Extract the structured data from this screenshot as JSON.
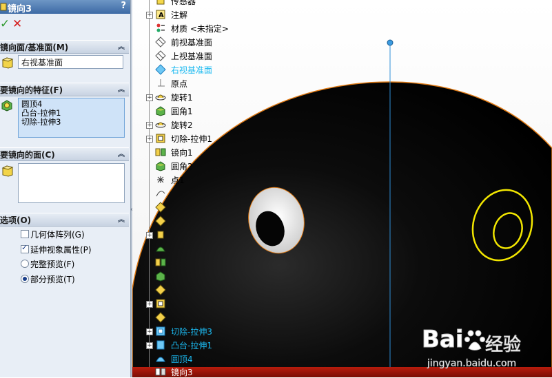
{
  "property_manager": {
    "title": "镜向3",
    "help": "?",
    "ok_symbol": "✓",
    "cancel_symbol": "✕",
    "mirror_plane": {
      "header": "镜向面/基准面(M)",
      "value": "右视基准面"
    },
    "features": {
      "header": "要镜向的特征(F)",
      "items": [
        "圆顶4",
        "凸台-拉伸1",
        "切除-拉伸3"
      ]
    },
    "faces": {
      "header": "要镜向的面(C)"
    },
    "options": {
      "header": "选项(O)",
      "geometry_pattern": {
        "label": "几何体阵列(G)",
        "checked": false
      },
      "propagate_visual": {
        "label": "延伸视象属性(P)",
        "checked": true
      },
      "full_preview": {
        "label": "完整预览(F)",
        "selected": false
      },
      "partial_preview": {
        "label": "部分预览(T)",
        "selected": true
      }
    },
    "collapse_symbol": "︽",
    "handle_symbol": "‹"
  },
  "feature_tree": {
    "items": [
      {
        "label": "传感器",
        "icon": "sensor-icon"
      },
      {
        "label": "注解",
        "icon": "annotation-icon"
      },
      {
        "label": "材质 <未指定>",
        "icon": "material-icon"
      },
      {
        "label": "前视基准面",
        "icon": "plane-icon"
      },
      {
        "label": "上视基准面",
        "icon": "plane-icon"
      },
      {
        "label": "右视基准面",
        "icon": "plane-icon"
      },
      {
        "label": "原点",
        "icon": "origin-icon"
      },
      {
        "label": "旋转1",
        "icon": "revolve-icon"
      },
      {
        "label": "圆角1",
        "icon": "fillet-icon"
      },
      {
        "label": "旋转2",
        "icon": "revolve-icon"
      },
      {
        "label": "切除-拉伸1",
        "icon": "cut-extrude-icon"
      },
      {
        "label": "镜向1",
        "icon": "mirror-icon"
      },
      {
        "label": "圆角2",
        "icon": "fillet-icon"
      },
      {
        "label": "点1",
        "icon": "point-icon"
      },
      {
        "label": "切除-拉伸3",
        "icon": "cut-extrude-icon"
      },
      {
        "label": "凸台-拉伸1",
        "icon": "boss-extrude-icon"
      },
      {
        "label": "圆顶4",
        "icon": "dome-icon"
      },
      {
        "label": "镜向3",
        "icon": "mirror-icon"
      }
    ],
    "expand_symbol": "+"
  },
  "watermark": {
    "brand": "Bai",
    "brand2": "经验",
    "url": "jingyan.baidu.com"
  },
  "colors": {
    "model_body": "#000000",
    "model_edge": "#e07a14",
    "sketch_highlight": "#f2e600",
    "plane_line": "#2f8fd8",
    "selection_text": "#1bb9f0"
  }
}
